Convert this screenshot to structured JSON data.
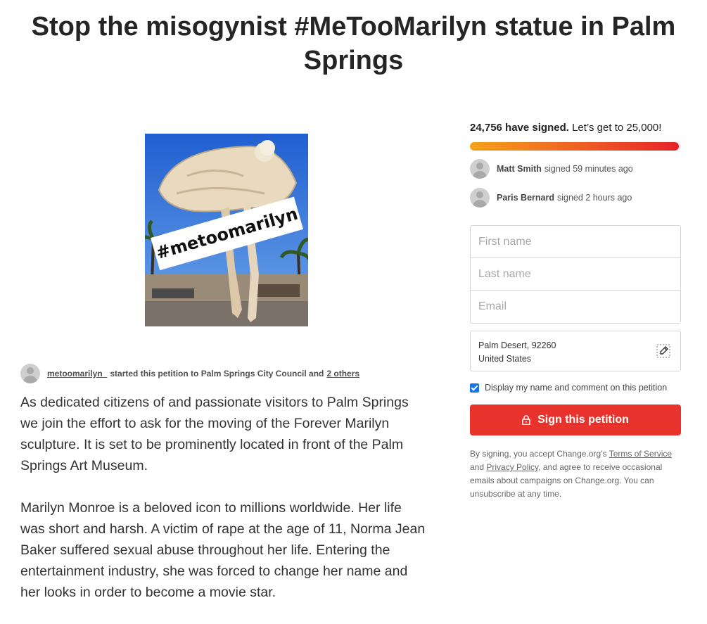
{
  "page": {
    "title": "Stop the misogynist #MeTooMarilyn statue in Palm Springs"
  },
  "hero": {
    "image_caption": "#metoomarilyn"
  },
  "starter": {
    "username": "metoomarilyn_",
    "action_text": "started this petition to Palm Springs City Council and",
    "others_link": "2 others"
  },
  "description": {
    "paragraphs": [
      "As dedicated citizens of and passionate visitors to Palm Springs we join the effort to ask for the moving of the Forever Marilyn sculpture. It is set to be prominently located in front of the Palm Springs Art Museum.",
      "Marilyn Monroe is a beloved icon to millions worldwide. Her life was short and harsh. A victim of rape at the age of 11, Norma Jean Baker suffered sexual abuse throughout her life. Entering the entertainment industry, she was forced to change her name and her looks in order to become a movie star."
    ]
  },
  "signatures": {
    "count_text": "24,756 have signed.",
    "goal_text": "Let’s get to 25,000!",
    "count": 24756,
    "goal": 25000,
    "progress_fraction": 0.99,
    "gradient_start": "#f5a31a",
    "gradient_end": "#e8222a"
  },
  "recent_signers": [
    {
      "name": "Matt Smith",
      "when": "signed 59 minutes ago",
      "icon": "avatar-placeholder-icon"
    },
    {
      "name": "Paris Bernard",
      "when": "signed 2 hours ago",
      "icon": "avatar-placeholder-icon"
    }
  ],
  "form": {
    "first_name_placeholder": "First name",
    "last_name_placeholder": "Last name",
    "email_placeholder": "Email",
    "location_line1": "Palm Desert, 92260",
    "location_line2": "United States",
    "edit_icon": "edit-pencil-icon",
    "display_checkbox_label": "Display my name and comment on this petition",
    "display_checked": true,
    "sign_button_label": "Sign this petition",
    "sign_button_icon": "lock-icon",
    "sign_button_color": "#e8322c"
  },
  "legal": {
    "prefix": "By signing, you accept Change.org’s",
    "terms_link": "Terms of Service",
    "and": "and",
    "privacy_link": "Privacy Policy",
    "suffix": ", and agree to receive occasional emails about campaigns on Change.org. You can unsubscribe at any time."
  }
}
